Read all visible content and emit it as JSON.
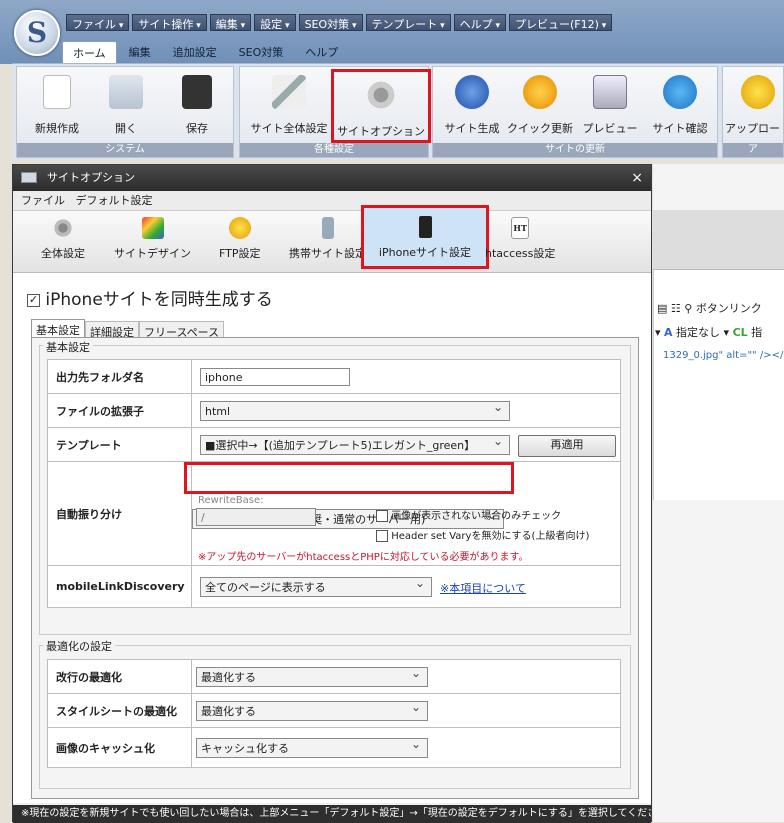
{
  "app": {
    "logo_char": "S",
    "menus": [
      "ファイル",
      "サイト操作",
      "編集",
      "設定",
      "SEO対策",
      "テンプレート",
      "ヘルプ",
      "プレビュー(F12)"
    ],
    "tabs": [
      "ホーム",
      "編集",
      "追加設定",
      "SEO対策",
      "ヘルプ"
    ],
    "ribbon": {
      "groups": [
        {
          "label": "システム",
          "buttons": [
            "新規作成",
            "開く",
            "保存"
          ]
        },
        {
          "label": "各種設定",
          "buttons": [
            "サイト全体設定",
            "サイトオプション"
          ]
        },
        {
          "label": "サイトの更新",
          "buttons": [
            "サイト生成",
            "クイック更新",
            "プレビュー",
            "サイト確認"
          ]
        },
        {
          "label": "ア",
          "buttons": [
            "アップロート"
          ]
        }
      ]
    },
    "right_panel": {
      "button_link": "ボタンリンク",
      "style_none": "指定なし",
      "style_extra": "指",
      "code": "1329_0.jpg\"  alt=\"\" /></a>"
    }
  },
  "dialog": {
    "title": "サイトオプション",
    "close": "×",
    "menu": [
      "ファイル",
      "デフォルト設定"
    ],
    "toolbar": [
      "全体設定",
      "サイトデザイン",
      "FTP設定",
      "携帯サイト設定",
      "iPhoneサイト設定",
      "htaccess設定"
    ],
    "enable_label": "iPhoneサイトを同時生成する",
    "subtabs": [
      "基本設定",
      "詳細設定",
      "フリースペース"
    ],
    "basic": {
      "legend": "基本設定",
      "output_folder_label": "出力先フォルダ名",
      "output_folder_value": "iphone",
      "extension_label": "ファイルの拡張子",
      "extension_value": "html",
      "template_label": "テンプレート",
      "template_value": "■選択中→【(追加テンプレート5)エレガント_green】",
      "reapply": "再適用",
      "auto_label": "自動振り分け",
      "auto_value": "同一URLで振り分け(推奨・通常のサーバー用)",
      "rewrite_label": "RewriteBase:",
      "rewrite_value": "/",
      "check1": "画像が表示されない場合のみチェック",
      "check2": "Header set Varyを無効にする(上級者向け)",
      "warning": "※アップ先のサーバーがhtaccessとPHPに対応している必要があります。",
      "mld_label": "mobileLinkDiscovery",
      "mld_value": "全てのページに表示する",
      "mld_link": "※本項目について"
    },
    "optimize": {
      "legend": "最適化の設定",
      "newline_label": "改行の最適化",
      "newline_value": "最適化する",
      "style_label": "スタイルシートの最適化",
      "style_value": "最適化する",
      "cache_label": "画像のキャッシュ化",
      "cache_value": "キャッシュ化する"
    },
    "status": "※現在の設定を新規サイトでも使い回したい場合は、上部メニュー「デフォルト設定」→「現在の設定をデフォルトにする」を選択してください。"
  }
}
